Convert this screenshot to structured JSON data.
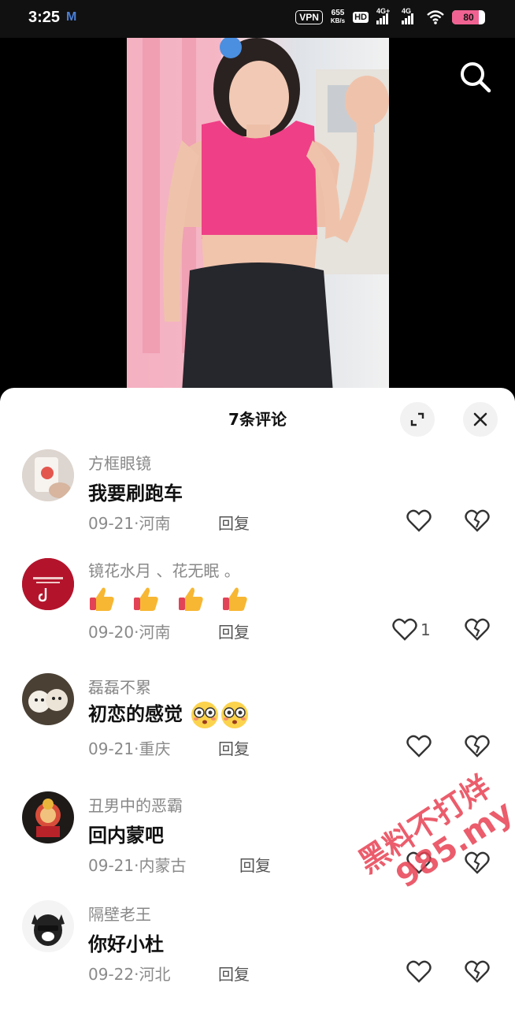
{
  "status_bar": {
    "time": "3:25",
    "mail_icon": "M",
    "vpn": "VPN",
    "speed_value": "655",
    "speed_unit": "KB/s",
    "hd": "HD",
    "net1": "4G+",
    "net2": "4G",
    "battery": "80",
    "battery_level": 0.8
  },
  "video": {
    "search_icon": "search-icon"
  },
  "comments_sheet": {
    "title": "7条评论",
    "expand_icon": "expand-icon",
    "close_icon": "close-icon",
    "comments": [
      {
        "user": "方框眼镜",
        "text": "我要刷跑车",
        "date": "09-21",
        "location": "河南",
        "reply": "回复",
        "likes": ""
      },
      {
        "user": "镜花水月 、花无眠 。",
        "text": "",
        "emoji": [
          "thumbs-up",
          "thumbs-up",
          "thumbs-up",
          "thumbs-up"
        ],
        "date": "09-20",
        "location": "河南",
        "reply": "回复",
        "likes": "1"
      },
      {
        "user": "磊磊不累",
        "text": "初恋的感觉",
        "emoji_after": [
          "flushed-face",
          "flushed-face"
        ],
        "date": "09-21",
        "location": "重庆",
        "reply": "回复",
        "likes": ""
      },
      {
        "user": "丑男中的恶霸",
        "text": "回内蒙吧",
        "date": "09-21",
        "location": "内蒙古",
        "reply": "回复",
        "likes": ""
      },
      {
        "user": "隔壁老王",
        "text": "你好小杜",
        "date": "09-22",
        "location": "河北",
        "reply": "回复",
        "likes": ""
      }
    ]
  },
  "watermark": {
    "line1": "黑料不打烊",
    "line2": "985.my"
  },
  "colors": {
    "accent_pink": "#f06292",
    "watermark": "#e74152"
  }
}
